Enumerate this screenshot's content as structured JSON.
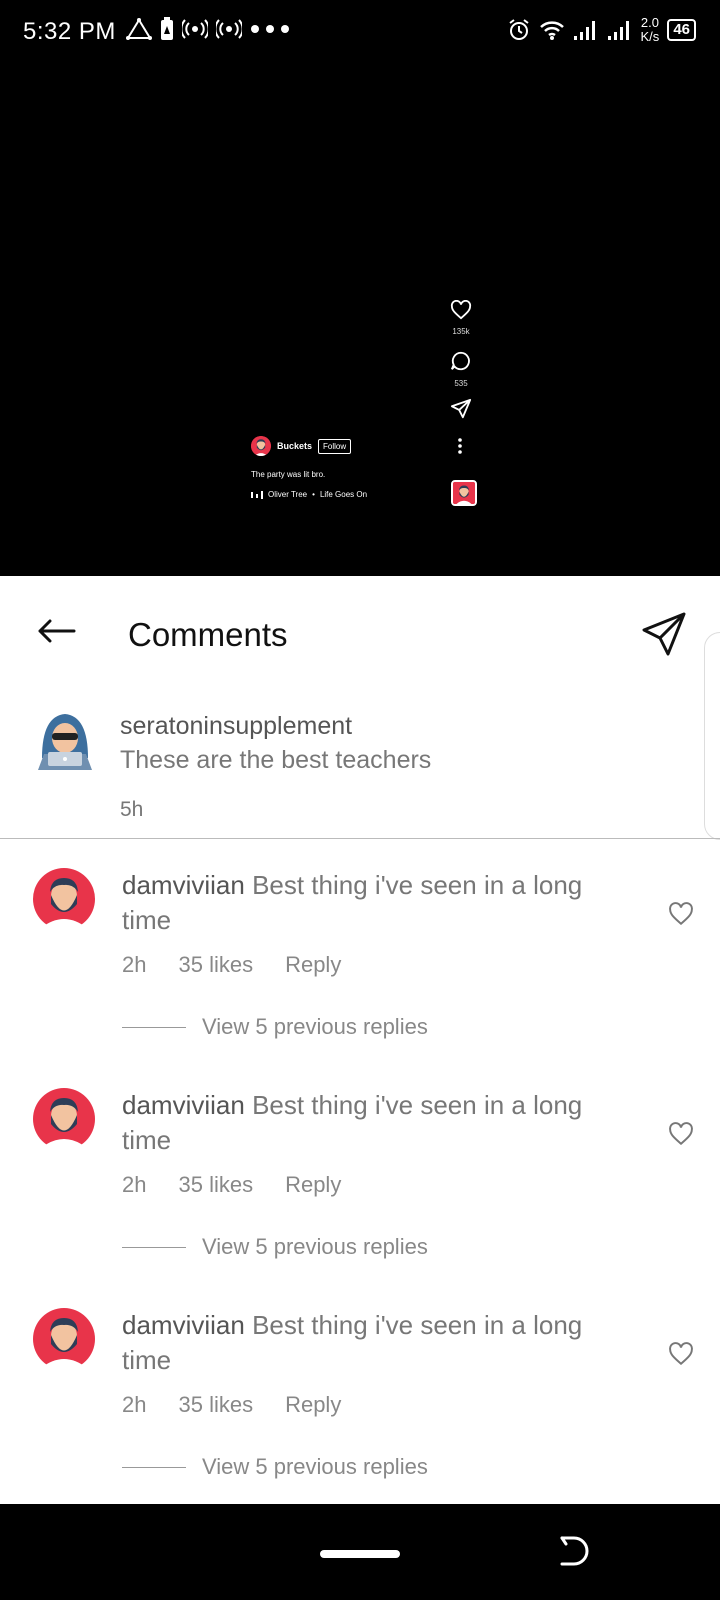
{
  "status_bar": {
    "time": "5:32 PM",
    "left_icons": [
      "triangle-icon",
      "battery-saver-icon",
      "hotspot-icon",
      "hotspot-icon",
      "more-dots-icon"
    ],
    "network_speed_value": "2.0",
    "network_speed_unit": "K/s",
    "battery": "46"
  },
  "video": {
    "likes": "135k",
    "comments": "535",
    "owner_name": "Buckets",
    "follow_label": "Follow",
    "caption": "The party was lit bro.",
    "music_artist": "Oliver Tree",
    "music_separator": "•",
    "music_title": "Life Goes On"
  },
  "sheet": {
    "title": "Comments",
    "caption": {
      "username": "seratoninsupplement",
      "text": "These are the best teachers",
      "time": "5h"
    },
    "comments": [
      {
        "username": "damviviian",
        "text": "Best thing i've seen in a long time",
        "time": "2h",
        "likes": "35 likes",
        "reply": "Reply",
        "view_replies": "View 5 previous replies"
      },
      {
        "username": "damviviian",
        "text": "Best thing i've seen in a long time",
        "time": "2h",
        "likes": "35 likes",
        "reply": "Reply",
        "view_replies": "View 5 previous replies"
      },
      {
        "username": "damviviian",
        "text": "Best thing i've seen in a long time",
        "time": "2h",
        "likes": "35 likes",
        "reply": "Reply",
        "view_replies": "View 5 previous replies"
      }
    ]
  },
  "colors": {
    "avatar_red": "#e8344a",
    "hood_blue": "#3d6f9e"
  }
}
